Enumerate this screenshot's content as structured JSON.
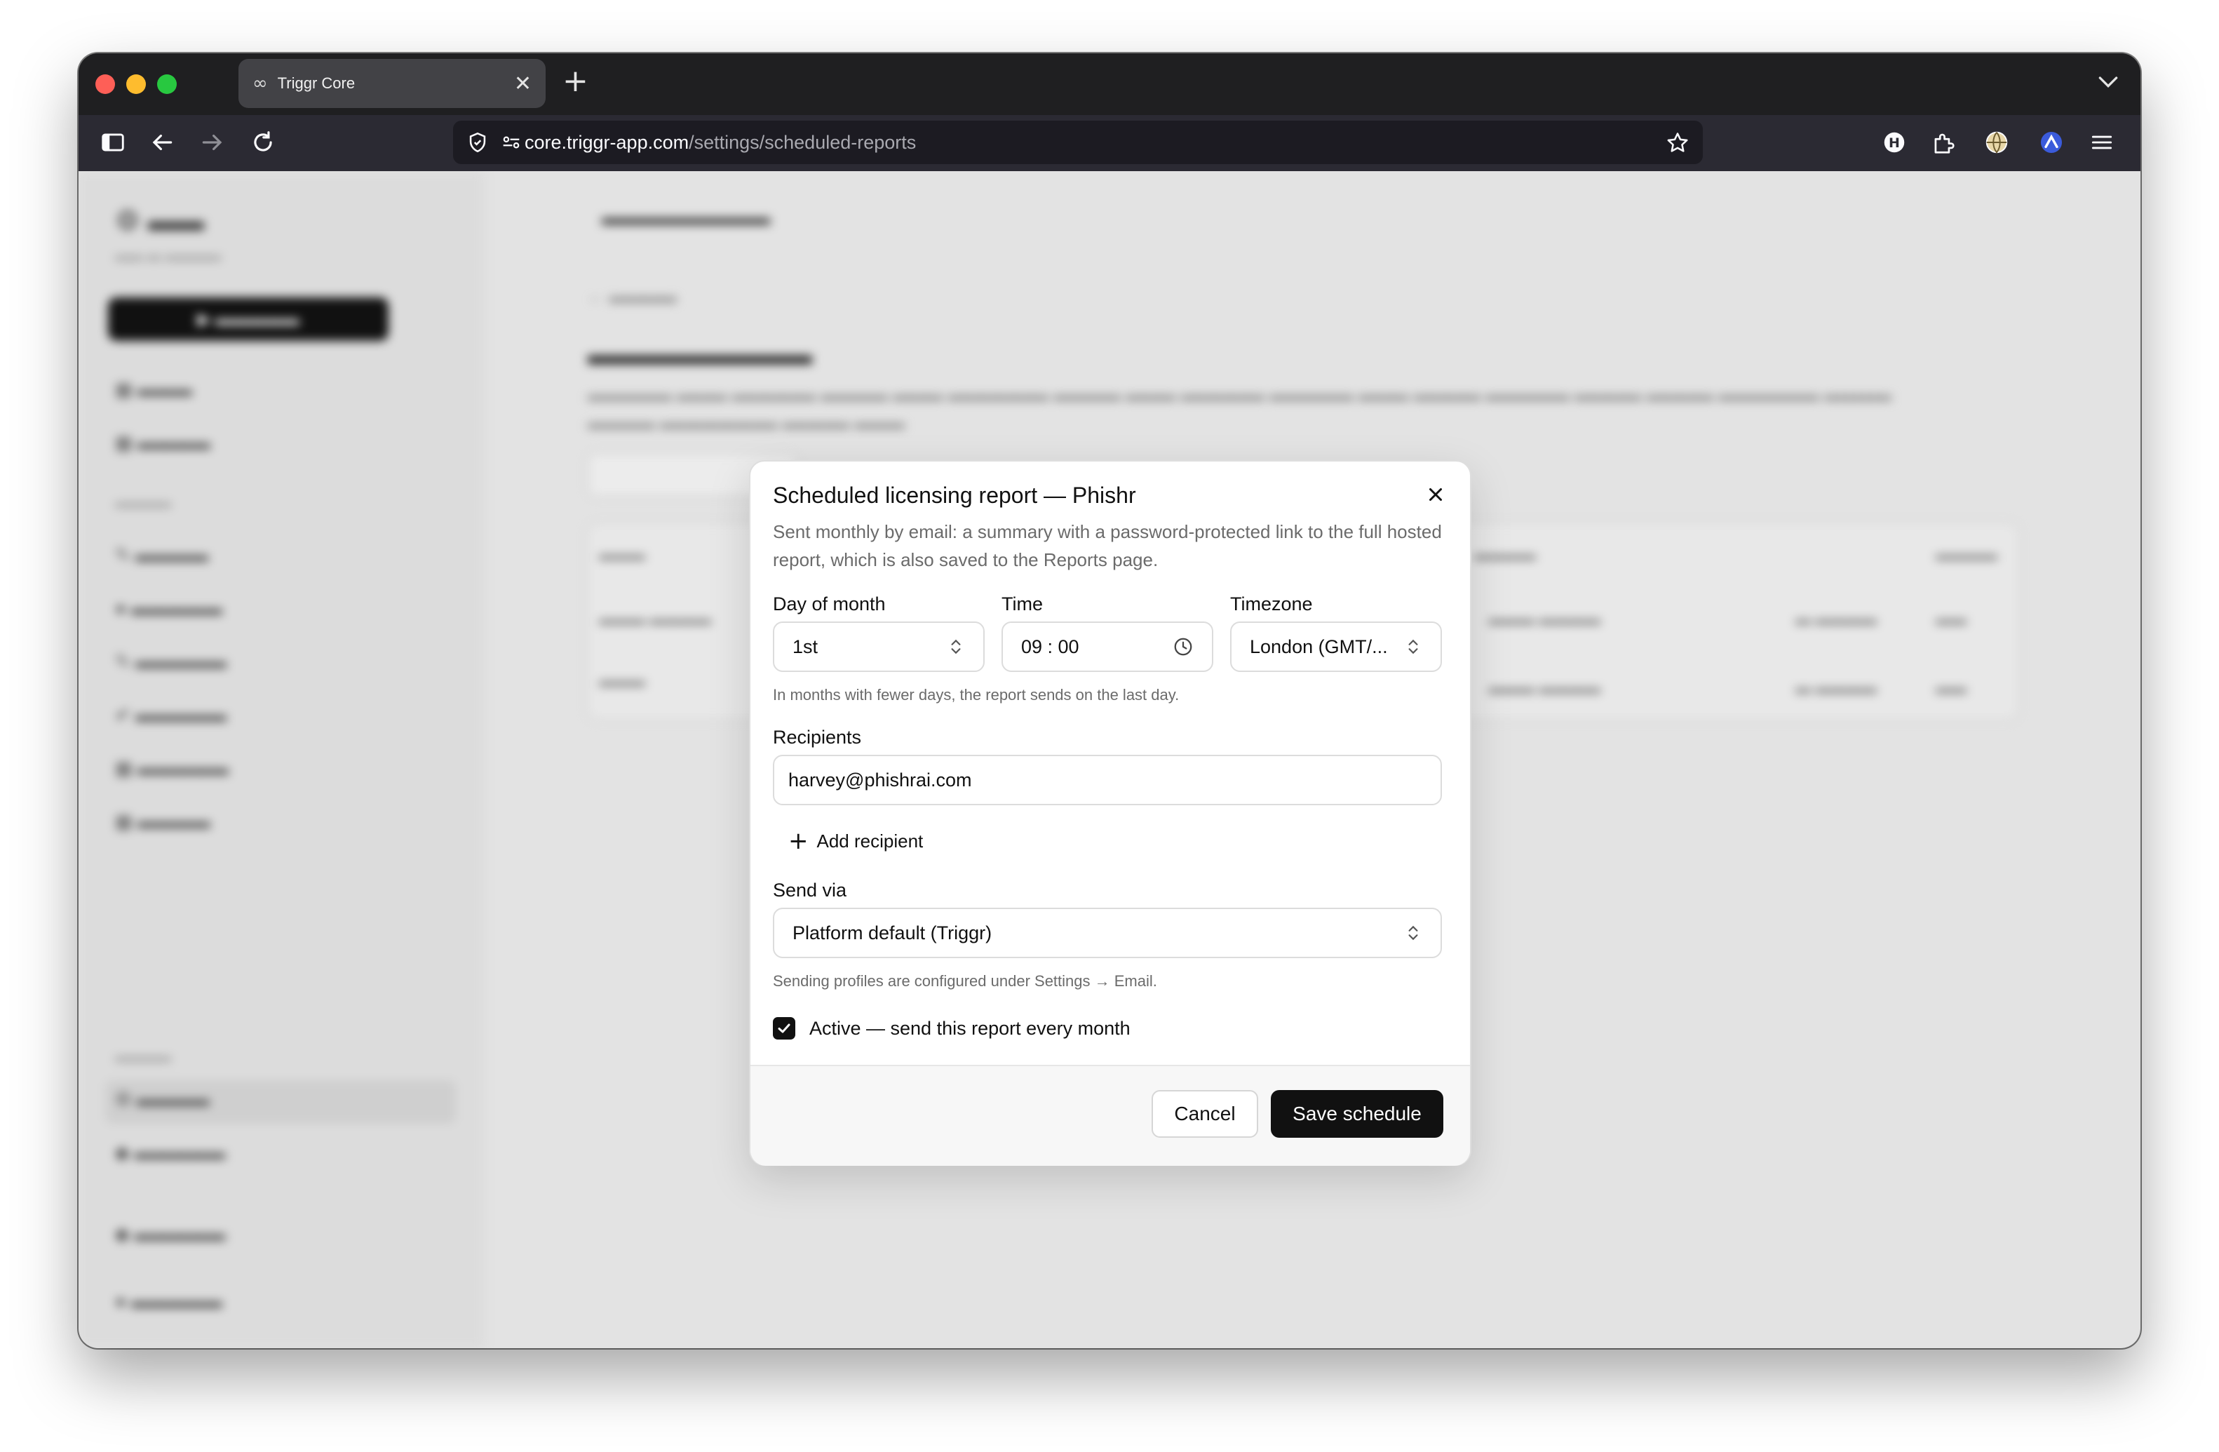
{
  "browser": {
    "tab_title": "Triggr Core",
    "url_host": "core.triggr-app.com",
    "url_path": "/settings/scheduled-reports"
  },
  "modal": {
    "title": "Scheduled licensing report — Phishr",
    "description": "Sent monthly by email: a summary with a password-protected link to the full hosted report, which is also saved to the Reports page.",
    "day_label": "Day of month",
    "day_value": "1st",
    "time_label": "Time",
    "time_value": "09 : 00",
    "timezone_label": "Timezone",
    "timezone_value": "London (GMT/...",
    "day_hint": "In months with fewer days, the report sends on the last day.",
    "recipients_label": "Recipients",
    "recipient_value": "harvey@phishrai.com",
    "add_recipient": "Add recipient",
    "send_via_label": "Send via",
    "send_via_value": "Platform default (Triggr)",
    "send_via_hint": "Sending profiles are configured under Settings → Email.",
    "active_label": "Active — send this report every month",
    "active_checked": true,
    "cancel_label": "Cancel",
    "save_label": "Save schedule"
  },
  "colors": {
    "primary": "#111111",
    "overlay": "#e3e3e3"
  }
}
